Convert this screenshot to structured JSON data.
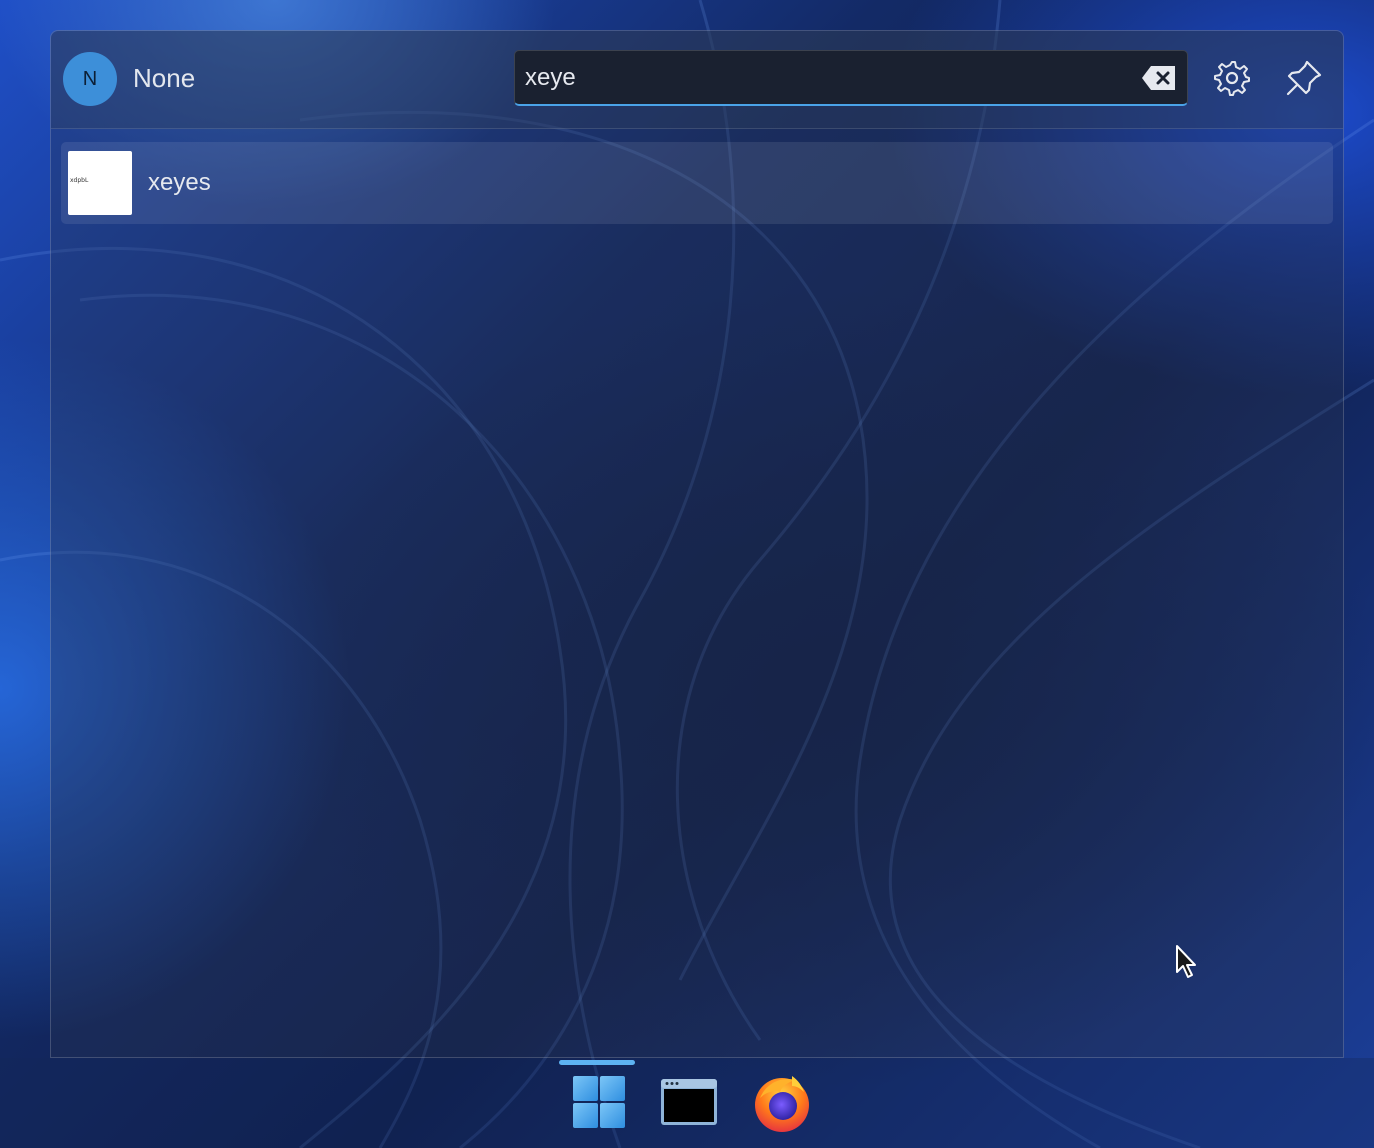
{
  "user": {
    "initial": "N",
    "name": "None"
  },
  "search": {
    "value": "xeye",
    "placeholder": ""
  },
  "icons": {
    "clear": "backspace-clear-icon",
    "settings": "gear-icon",
    "pin": "pin-icon",
    "start": "windows-start-icon",
    "terminal": "terminal-icon",
    "firefox": "firefox-icon"
  },
  "results": [
    {
      "name": "xeyes",
      "icon_text": "xdpbL"
    }
  ],
  "colors": {
    "accent": "#4aa3e8",
    "avatar": "#3d8fd9"
  }
}
